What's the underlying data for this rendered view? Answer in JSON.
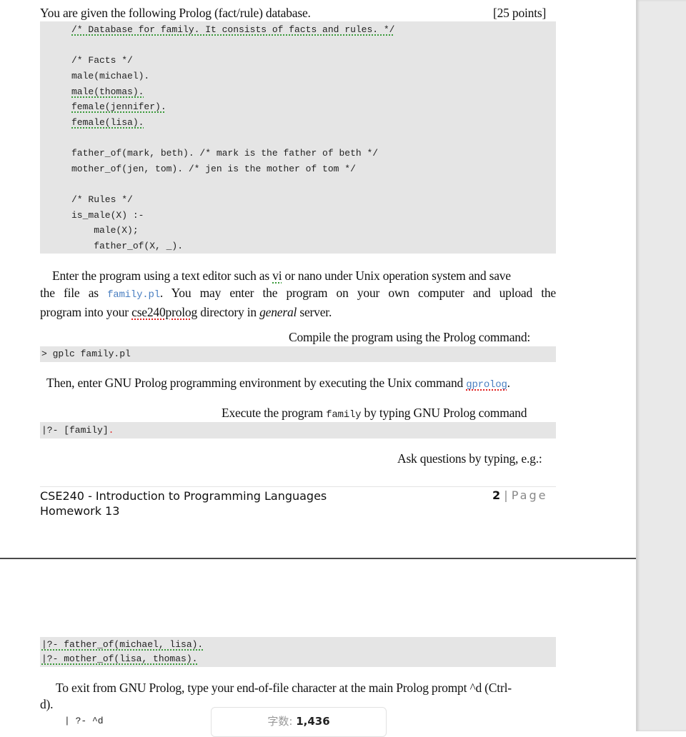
{
  "question": {
    "intro": "You are given the following Prolog (fact/rule) database.",
    "points": "[25 points]"
  },
  "code_block": {
    "lines": [
      "/* Database for family. It consists of facts and rules. */",
      "",
      "/* Facts */",
      "male(michael).",
      "male(thomas).",
      "female(jennifer).",
      "female(lisa).",
      "",
      "father_of(mark, beth). /* mark is the father of beth */",
      "mother_of(jen, tom). /* jen is the mother of tom */",
      "",
      "/* Rules */",
      "is_male(X) :-",
      "    male(X);",
      "    father_of(X, _)."
    ]
  },
  "instructions": {
    "para1_part1": "Enter the program using a text editor such as ",
    "para1_vi": "vi",
    "para1_part2": " or nano under Unix operation system and save",
    "para1_part3": "the file as ",
    "para1_filename": "family.pl",
    "para1_part4": ". You may enter the program on your own computer and upload the",
    "para1_part5": "program into your ",
    "para1_dir": "cse240prolog",
    "para1_part6": " directory in ",
    "para1_server": "general",
    "para1_part7": " server.",
    "compile_label": "Compile the program using the Prolog command:",
    "compile_cmd": "> gplc family.pl",
    "enter_env_text": "Then, enter GNU Prolog programming environment by executing the Unix command ",
    "enter_env_cmd": "gprolog",
    "enter_env_end": ".",
    "execute_label_part1": "Execute the program ",
    "execute_label_code": "family",
    "execute_label_part2": " by typing GNU Prolog command",
    "execute_cmd": "|?- [family]",
    "execute_cmd_dot": ".",
    "ask_label": "Ask questions by typing, e.g.:"
  },
  "footer": {
    "course": "CSE240 - Introduction to Programming Languages",
    "homework": "Homework 13",
    "page_number": "2",
    "page_sep": " | ",
    "page_word": "Page"
  },
  "queries": [
    "|?- father_of(michael, lisa).",
    "|?- mother_of(lisa, thomas)."
  ],
  "exit": {
    "text_line1": "To exit from GNU Prolog, type your end-of-file character at the main Prolog prompt  ^d (Ctrl-",
    "text_line2": "d).",
    "cmd": "| ?- ^d"
  },
  "word_count": {
    "label": "字数: ",
    "value": "1,436"
  }
}
